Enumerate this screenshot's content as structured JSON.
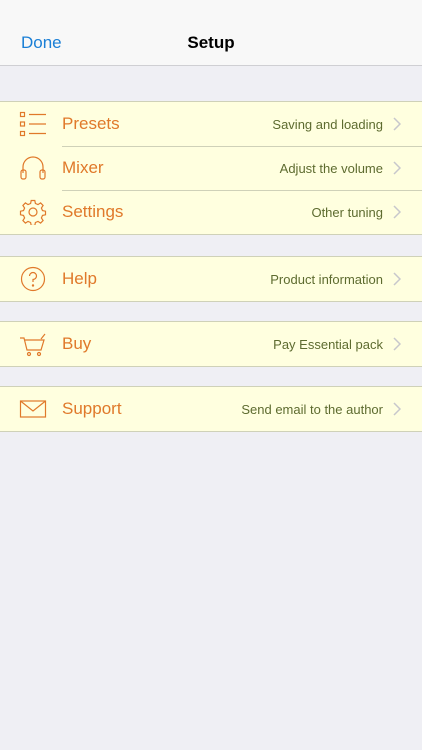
{
  "navbar": {
    "done_label": "Done",
    "title": "Setup"
  },
  "colors": {
    "accent_orange": "#e0792a",
    "detail_green": "#5d6b2f",
    "row_background": "#ffffdf",
    "link_blue": "#1a7fd6",
    "page_background": "#efeff4"
  },
  "groups": [
    {
      "rows": [
        {
          "icon": "list-icon",
          "label": "Presets",
          "detail": "Saving and loading"
        },
        {
          "icon": "headphones-icon",
          "label": "Mixer",
          "detail": "Adjust the volume"
        },
        {
          "icon": "gear-icon",
          "label": "Settings",
          "detail": "Other tuning"
        }
      ]
    },
    {
      "rows": [
        {
          "icon": "help-icon",
          "label": "Help",
          "detail": "Product information"
        }
      ]
    },
    {
      "rows": [
        {
          "icon": "cart-icon",
          "label": "Buy",
          "detail": "Pay Essential pack"
        }
      ]
    },
    {
      "rows": [
        {
          "icon": "envelope-icon",
          "label": "Support",
          "detail": "Send email to the author"
        }
      ]
    }
  ]
}
